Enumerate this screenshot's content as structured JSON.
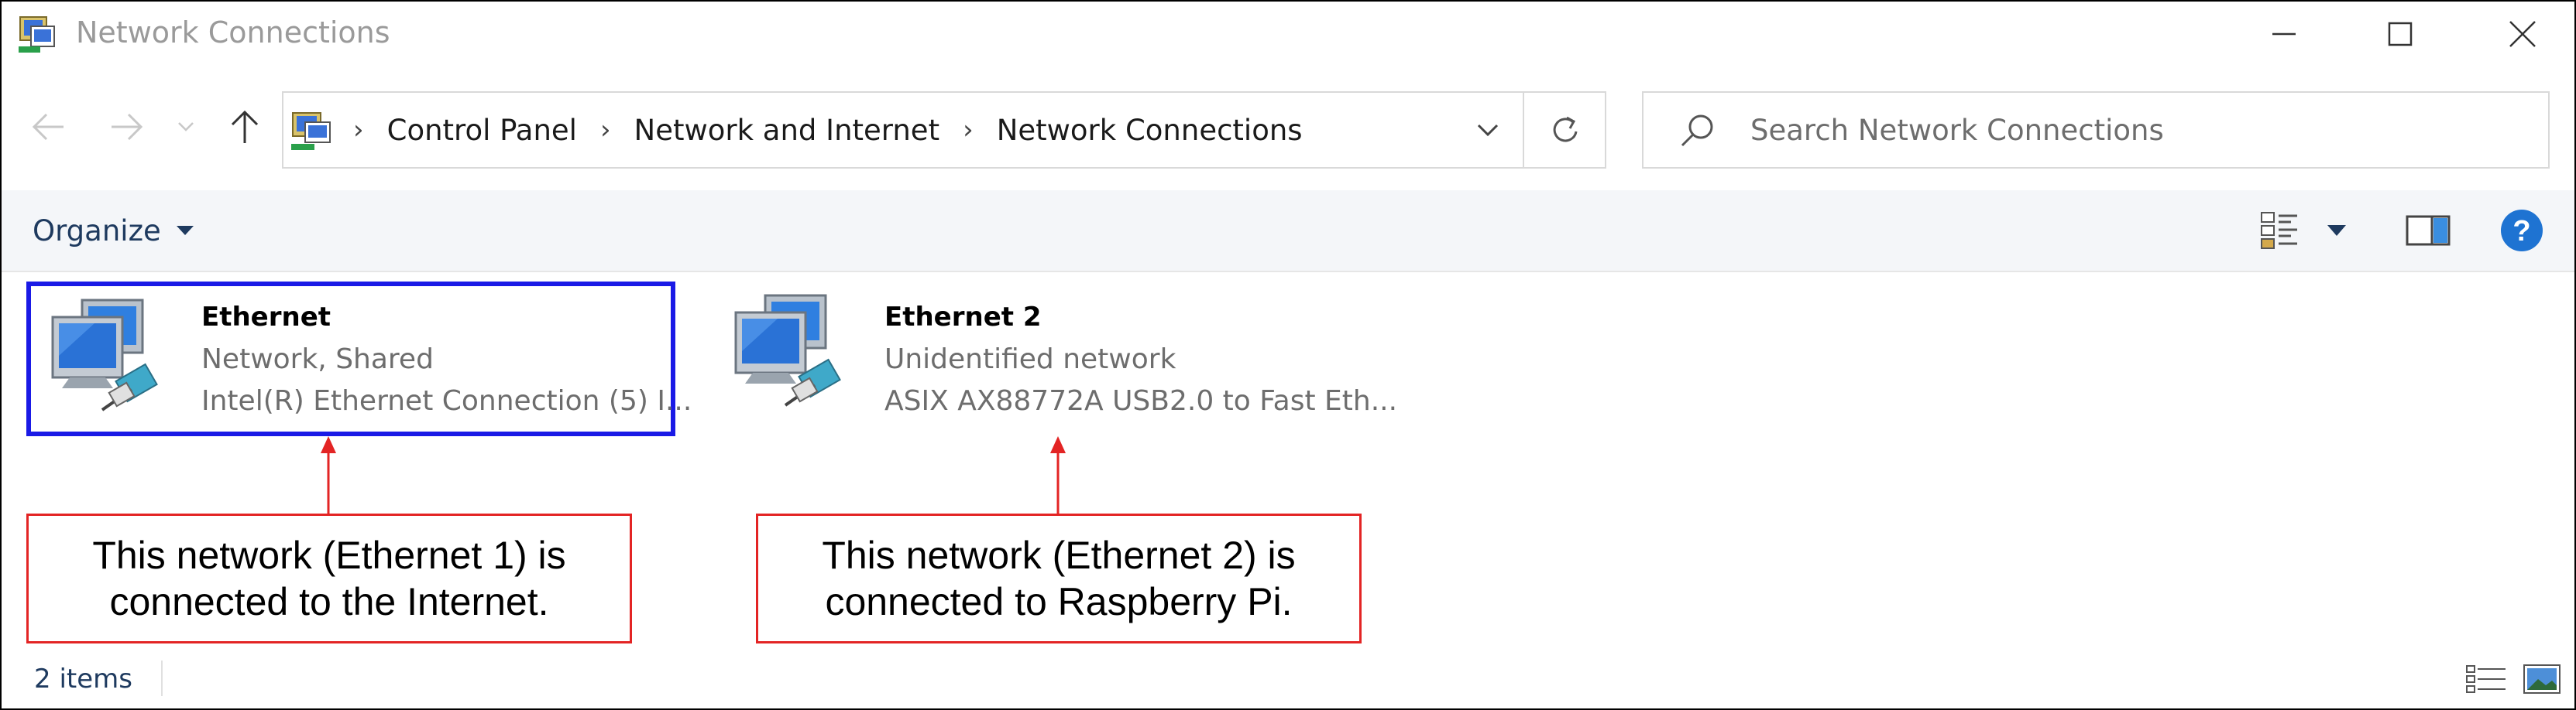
{
  "window": {
    "title": "Network Connections"
  },
  "address_bar": {
    "crumbs": [
      "Control Panel",
      "Network and Internet",
      "Network Connections"
    ]
  },
  "search": {
    "placeholder": "Search Network Connections"
  },
  "command_bar": {
    "organize_label": "Organize"
  },
  "connections": [
    {
      "name": "Ethernet",
      "status": "Network, Shared",
      "device": "Intel(R) Ethernet Connection (5) I...",
      "selected": true
    },
    {
      "name": "Ethernet 2",
      "status": "Unidentified network",
      "device": "ASIX AX88772A USB2.0 to Fast Eth...",
      "selected": false
    }
  ],
  "annotations": [
    {
      "text": "This network (Ethernet 1) is\nconnected to the Internet."
    },
    {
      "text": "This network (Ethernet 2) is\nconnected to Raspberry Pi."
    }
  ],
  "status_bar": {
    "item_count": "2 items"
  },
  "colors": {
    "selection_border": "#1a1ae6",
    "annotation_red": "#e32424",
    "command_bar_bg": "#f4f6f9",
    "help_blue": "#1e73d2",
    "link_text": "#1e3a5f"
  }
}
